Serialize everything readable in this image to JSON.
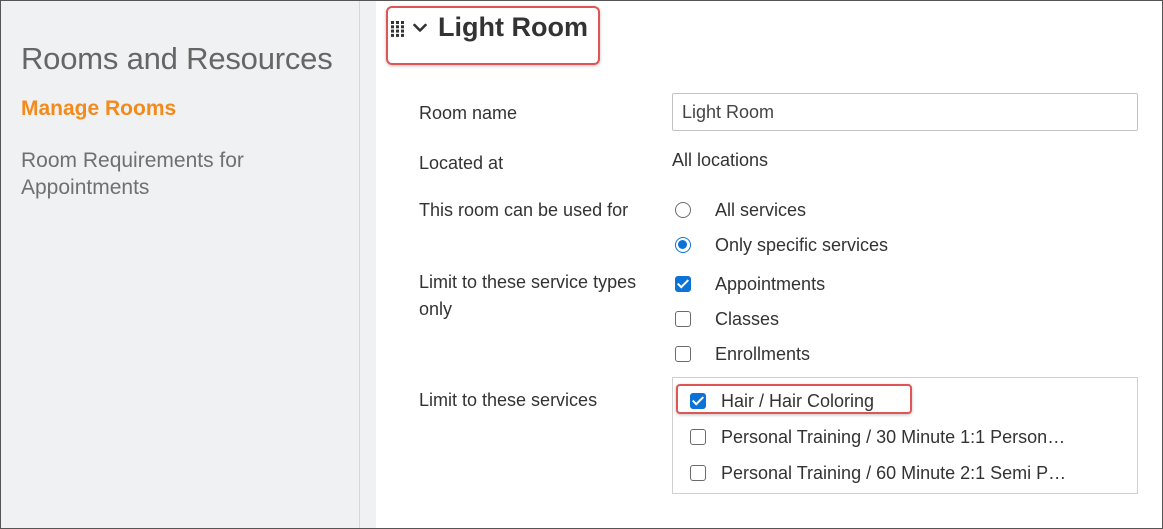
{
  "sidebar": {
    "title": "Rooms and Resources",
    "items": [
      {
        "label": "Manage Rooms",
        "active": true
      },
      {
        "label": "Room Requirements for Appointments",
        "active": false
      }
    ]
  },
  "header": {
    "title": "Light Room",
    "icons": [
      "drag-grip-icon",
      "chevron-down-icon"
    ]
  },
  "form": {
    "room_name_label": "Room name",
    "room_name_value": "Light Room",
    "located_label": "Located at",
    "located_value": "All locations",
    "usage_label": "This room can be used for",
    "usage_options": [
      {
        "label": "All services",
        "selected": false
      },
      {
        "label": "Only specific services",
        "selected": true
      }
    ],
    "service_types_label": "Limit to these service types only",
    "service_types": [
      {
        "label": "Appointments",
        "checked": true
      },
      {
        "label": "Classes",
        "checked": false
      },
      {
        "label": "Enrollments",
        "checked": false
      }
    ],
    "services_label": "Limit to these services",
    "services": [
      {
        "label": "Hair / Hair Coloring",
        "checked": true
      },
      {
        "label": "Personal Training / 30 Minute 1:1 Person…",
        "checked": false
      },
      {
        "label": "Personal Training / 60 Minute 2:1 Semi P…",
        "checked": false
      }
    ]
  },
  "colors": {
    "accent_orange": "#f28a1c",
    "control_blue": "#0b73d8",
    "highlight_red": "#dd5555",
    "sidebar_bg": "#f0f1f2"
  }
}
